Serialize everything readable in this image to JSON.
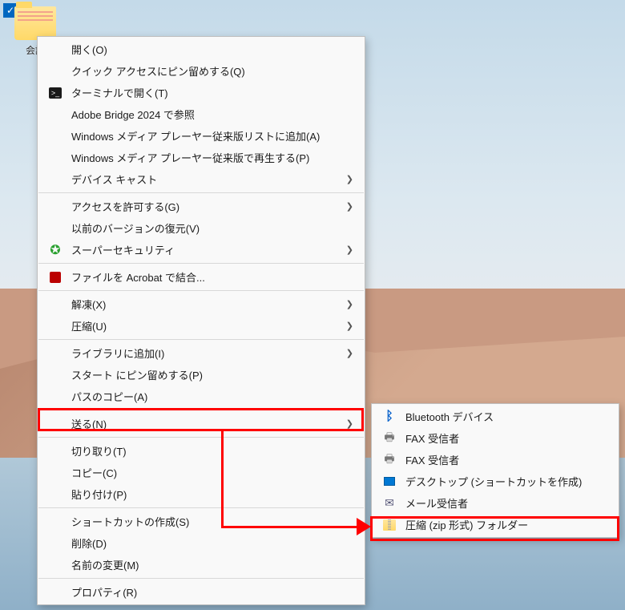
{
  "desktop": {
    "folder_label": "会議"
  },
  "main_menu": {
    "groups": [
      [
        {
          "icon": "",
          "label": "開く(O)",
          "sub": false
        },
        {
          "icon": "",
          "label": "クイック アクセスにピン留めする(Q)",
          "sub": false
        },
        {
          "icon": "terminal",
          "label": "ターミナルで開く(T)",
          "sub": false
        },
        {
          "icon": "",
          "label": "Adobe Bridge 2024 で参照",
          "sub": false
        },
        {
          "icon": "",
          "label": "Windows メディア プレーヤー従来版リストに追加(A)",
          "sub": false
        },
        {
          "icon": "",
          "label": "Windows メディア プレーヤー従来版で再生する(P)",
          "sub": false
        },
        {
          "icon": "",
          "label": "デバイス キャスト",
          "sub": true
        }
      ],
      [
        {
          "icon": "",
          "label": "アクセスを許可する(G)",
          "sub": true
        },
        {
          "icon": "",
          "label": "以前のバージョンの復元(V)",
          "sub": false
        },
        {
          "icon": "shield",
          "label": "スーパーセキュリティ",
          "sub": true
        }
      ],
      [
        {
          "icon": "acrobat",
          "label": "ファイルを Acrobat で結合...",
          "sub": false
        }
      ],
      [
        {
          "icon": "",
          "label": "解凍(X)",
          "sub": true
        },
        {
          "icon": "",
          "label": "圧縮(U)",
          "sub": true
        }
      ],
      [
        {
          "icon": "",
          "label": "ライブラリに追加(I)",
          "sub": true
        },
        {
          "icon": "",
          "label": "スタート にピン留めする(P)",
          "sub": false
        },
        {
          "icon": "",
          "label": "パスのコピー(A)",
          "sub": false
        }
      ],
      [
        {
          "icon": "",
          "label": "送る(N)",
          "sub": true
        }
      ],
      [
        {
          "icon": "",
          "label": "切り取り(T)",
          "sub": false
        },
        {
          "icon": "",
          "label": "コピー(C)",
          "sub": false
        },
        {
          "icon": "",
          "label": "貼り付け(P)",
          "sub": false
        }
      ],
      [
        {
          "icon": "",
          "label": "ショートカットの作成(S)",
          "sub": false
        },
        {
          "icon": "",
          "label": "削除(D)",
          "sub": false
        },
        {
          "icon": "",
          "label": "名前の変更(M)",
          "sub": false
        }
      ],
      [
        {
          "icon": "",
          "label": "プロパティ(R)",
          "sub": false
        }
      ]
    ]
  },
  "sub_menu": {
    "items": [
      {
        "icon": "bt",
        "label": "Bluetooth デバイス"
      },
      {
        "icon": "fax",
        "label": "FAX 受信者"
      },
      {
        "icon": "fax",
        "label": "FAX 受信者"
      },
      {
        "icon": "desktop",
        "label": "デスクトップ (ショートカットを作成)"
      },
      {
        "icon": "mail",
        "label": "メール受信者"
      },
      {
        "icon": "zip",
        "label": "圧縮 (zip 形式) フォルダー"
      }
    ]
  }
}
